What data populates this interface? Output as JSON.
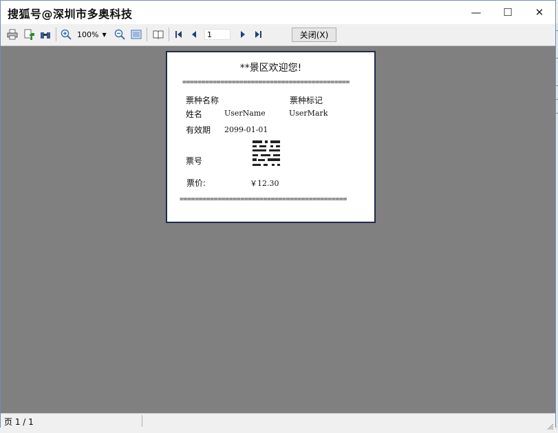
{
  "window": {
    "title": "搜狐号@深圳市多奥科技",
    "controls": {
      "minimize": "—",
      "maximize": "☐",
      "close": "✕"
    }
  },
  "toolbar": {
    "icons": [
      "print-icon",
      "export-icon",
      "find-icon",
      "zoom-in-icon",
      "zoom-out-icon",
      "page-setup-icon",
      "book-icon",
      "first-page-icon",
      "prev-page-icon",
      "next-page-icon",
      "last-page-icon"
    ],
    "zoom_value": "100%",
    "page_value": "1",
    "close_label": "关闭(X)"
  },
  "ticket": {
    "welcome": "**景区欢迎您!",
    "rule_top": "============================================",
    "ticket_type_label": "票种名称",
    "ticket_mark_label": "票种标记",
    "name_label": "姓名",
    "name_value": "UserName",
    "mark_value": "UserMark",
    "valid_label": "有效期",
    "valid_value": "2099-01-01",
    "ticket_no_label": "票号",
    "price_label": "票价:",
    "price_value": "￥12.30",
    "rule_bottom": "============================================"
  },
  "statusbar": {
    "page_info": "页 1 / 1"
  },
  "colors": {
    "canvas": "#808080",
    "paper_border": "#1f2a4d",
    "window_border": "#6d8fb5"
  }
}
